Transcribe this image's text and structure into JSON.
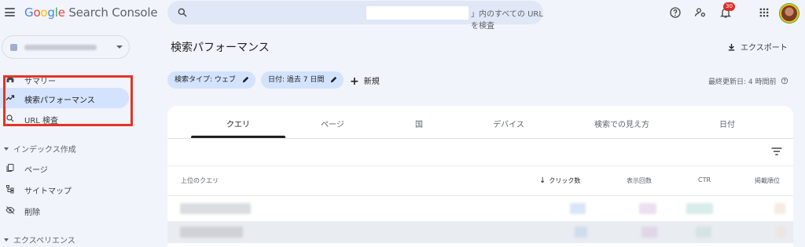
{
  "app": {
    "logo_google": [
      "G",
      "o",
      "o",
      "g",
      "l",
      "e"
    ],
    "logo_product": "Search Console"
  },
  "search": {
    "suffix_text": "」内のすべての URL を検査"
  },
  "topbar": {
    "notification_count": "30"
  },
  "sidebar": {
    "items": [
      {
        "label": "サマリー",
        "icon": "home-icon"
      },
      {
        "label": "検索パフォーマンス",
        "icon": "trending-up-icon",
        "active": true
      },
      {
        "label": "URL 検査",
        "icon": "search-icon"
      }
    ],
    "index_section": {
      "label": "インデックス作成",
      "items": [
        {
          "label": "ページ",
          "icon": "pages-icon"
        },
        {
          "label": "サイトマップ",
          "icon": "sitemap-icon"
        },
        {
          "label": "削除",
          "icon": "visibility-off-icon"
        }
      ]
    },
    "experience_section": {
      "label": "エクスペリエンス"
    }
  },
  "main": {
    "title": "検索パフォーマンス",
    "export_label": "エクスポート",
    "filters": [
      {
        "label": "検索タイプ: ウェブ"
      },
      {
        "label": "日付: 過去 7 日間"
      }
    ],
    "new_label": "新規",
    "last_updated": "最終更新日: 4 時間前"
  },
  "report": {
    "tabs": [
      "クエリ",
      "ページ",
      "国",
      "デバイス",
      "検索での見え方",
      "日付"
    ],
    "active_tab": 0,
    "columns": [
      "上位のクエリ",
      "クリック数",
      "表示回数",
      "CTR",
      "掲載順位"
    ],
    "sort_column": "クリック数"
  },
  "colors": {
    "accent": "#d3e3fd",
    "highlight_box": "#e53425",
    "background": "#f1f4fb"
  }
}
